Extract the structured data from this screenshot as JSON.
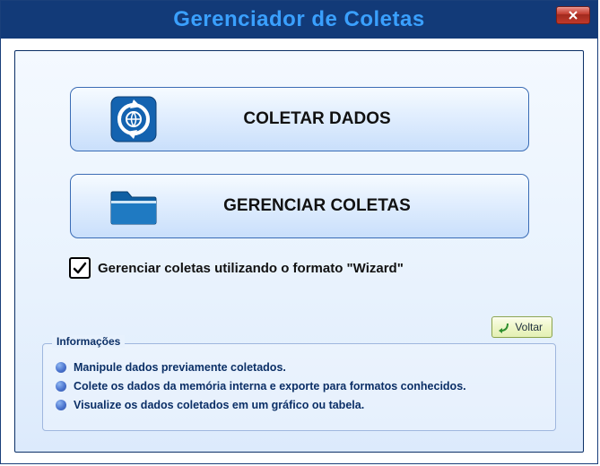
{
  "window": {
    "title": "Gerenciador de Coletas"
  },
  "actions": {
    "collect_label": "COLETAR DADOS",
    "manage_label": "GERENCIAR COLETAS"
  },
  "wizard_checkbox": {
    "label": "Gerenciar coletas utilizando o formato \"Wizard\"",
    "checked": true
  },
  "back_button": {
    "label": "Voltar"
  },
  "info": {
    "legend": "Informações",
    "items": [
      "Manipule dados previamente coletados.",
      "Colete os dados da memória interna e exporte para formatos conhecidos.",
      "Visualize os dados coletados em um gráfico ou tabela."
    ]
  },
  "colors": {
    "titlebar_bg": "#123a78",
    "title_fg": "#3aa0ff",
    "panel_border": "#0b2f66"
  }
}
